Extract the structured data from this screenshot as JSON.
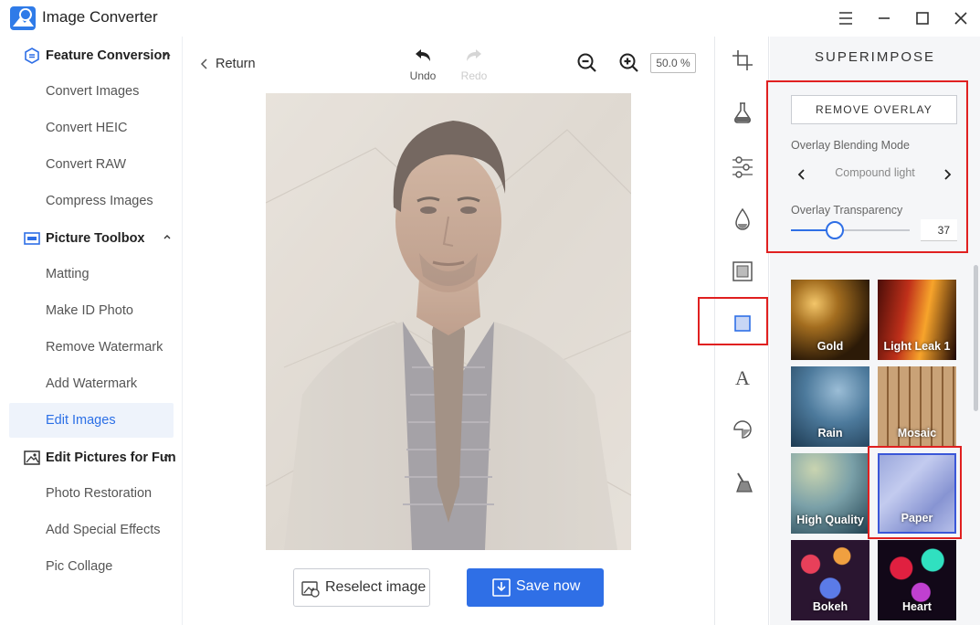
{
  "app": {
    "title": "Image Converter"
  },
  "sidebar": {
    "sections": [
      {
        "label": "Feature Conversion",
        "items": [
          "Convert Images",
          "Convert HEIC",
          "Convert RAW",
          "Compress Images"
        ]
      },
      {
        "label": "Picture Toolbox",
        "items": [
          "Matting",
          "Make ID Photo",
          "Remove Watermark",
          "Add Watermark",
          "Edit Images"
        ]
      },
      {
        "label": "Edit Pictures for Fun",
        "items": [
          "Photo Restoration",
          "Add Special Effects",
          "Pic Collage"
        ]
      }
    ],
    "active_item": "Edit Images"
  },
  "toolbar": {
    "return_label": "Return",
    "undo_label": "Undo",
    "redo_label": "Redo",
    "zoom_level": "50.0 %"
  },
  "actions": {
    "reselect_label": "Reselect image",
    "save_label": "Save now"
  },
  "tools": [
    "crop-icon",
    "flask-icon",
    "adjust-icon",
    "drop-icon",
    "frame-icon",
    "overlay-icon",
    "text-icon",
    "sticker-icon",
    "brush-icon"
  ],
  "panel": {
    "title": "SUPERIMPOSE",
    "remove_overlay_label": "REMOVE OVERLAY",
    "blend_mode_label": "Overlay Blending Mode",
    "blend_mode_value": "Compound light",
    "transparency_label": "Overlay Transparency",
    "transparency_value": "37",
    "transparency_fraction": 0.37,
    "overlays": [
      {
        "name": "Gold"
      },
      {
        "name": "Light Leak 1"
      },
      {
        "name": "Rain"
      },
      {
        "name": "Mosaic"
      },
      {
        "name": "High Quality"
      },
      {
        "name": "Paper",
        "selected": true
      },
      {
        "name": "Bokeh"
      },
      {
        "name": "Heart"
      }
    ]
  },
  "colors": {
    "accent": "#2f6fe6",
    "highlight": "#e02020",
    "save_button": "#2f6fe6"
  }
}
